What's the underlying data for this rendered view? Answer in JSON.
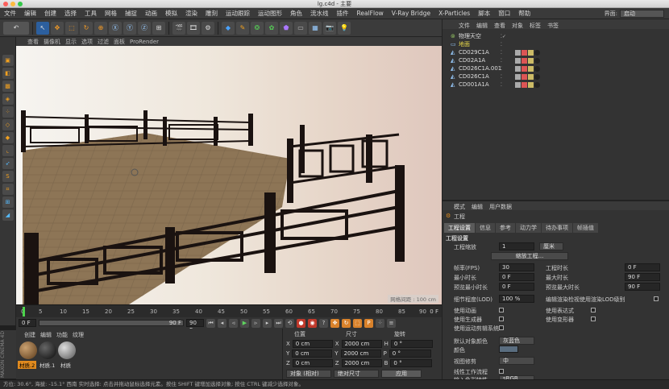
{
  "window": {
    "title": "lg.c4d - 主要"
  },
  "menubar": {
    "items": [
      "文件",
      "编辑",
      "创建",
      "选择",
      "工具",
      "网格",
      "捕捉",
      "动画",
      "模拟",
      "渲染",
      "雕刻",
      "运动跟踪",
      "运动图形",
      "角色",
      "流水线",
      "插件",
      "RealFlow",
      "V-Ray Bridge",
      "X-Particles",
      "脚本",
      "窗口",
      "帮助"
    ],
    "layout_label": "界面:",
    "layout_value": "启动"
  },
  "viewport": {
    "menu": [
      "查看",
      "摄像机",
      "显示",
      "选项",
      "过滤",
      "面板",
      "ProRender"
    ],
    "grid_label": "网格间距 : 100 cm"
  },
  "timeline": {
    "ticks": [
      "0",
      "5",
      "10",
      "15",
      "20",
      "25",
      "30",
      "35",
      "40",
      "45",
      "50",
      "55",
      "60",
      "65",
      "70",
      "75",
      "80",
      "85",
      "90"
    ],
    "frame_label": "0 F",
    "start": "0 F",
    "end_a": "90 F",
    "end_b": "90 F",
    "current_frame": 0
  },
  "material_panel": {
    "menu": [
      "创建",
      "编辑",
      "功能",
      "纹理"
    ],
    "materials": [
      "材质.2",
      "材质.1",
      "材质"
    ]
  },
  "coords": {
    "headers": [
      "位置",
      "尺寸",
      "旋转"
    ],
    "rows": [
      {
        "axis": "X",
        "pos": "0 cm",
        "size": "2000 cm",
        "rot_axis": "H",
        "rot": "0 °"
      },
      {
        "axis": "Y",
        "pos": "0 cm",
        "size": "2000 cm",
        "rot_axis": "P",
        "rot": "0 °"
      },
      {
        "axis": "Z",
        "pos": "0 cm",
        "size": "2000 cm",
        "rot_axis": "B",
        "rot": "0 °"
      }
    ],
    "mode_select": "对象 (相对)",
    "size_select": "绝对尺寸",
    "apply_button": "应用"
  },
  "status_bar": {
    "text": "方位: 30.6°, 海拔: -15.1° 西南   实时选择: 点击并拖动鼠标选择元素。按住 SHIFT 键增加选择对象; 按住 CTRL 键减少选择对象。"
  },
  "maxon_label": "MAXON CINEMA 4D",
  "object_manager": {
    "menu": [
      "文件",
      "编辑",
      "查看",
      "对象",
      "标签",
      "书签"
    ],
    "objects": [
      {
        "name": "物理天空",
        "color": "#9acd32"
      },
      {
        "name": "地面",
        "color": "#e8d94a"
      },
      {
        "name": "CD029C1A",
        "color": "#dddddd"
      },
      {
        "name": "CD02A1A",
        "color": "#dddddd"
      },
      {
        "name": "CD026C1A.001",
        "color": "#dddddd"
      },
      {
        "name": "CD026C1A",
        "color": "#dddddd"
      },
      {
        "name": "CD001A1A",
        "color": "#dddddd"
      }
    ]
  },
  "attribute_manager": {
    "menu": [
      "模式",
      "编辑",
      "用户数据"
    ],
    "title": "工程",
    "tabs": [
      "工程设置",
      "信息",
      "参考",
      "动力学",
      "待办事项",
      "帧插值"
    ],
    "section": "工程设置",
    "scale_label": "工程缩放",
    "scale_value": "1",
    "scale_unit": "厘米",
    "scale_button": "缩放工程...",
    "fields": [
      {
        "label": "帧率(FPS)",
        "value": "30"
      },
      {
        "label": "最小时长",
        "value": "0 F"
      },
      {
        "label": "预览最小时长",
        "value": "0 F"
      }
    ],
    "fields_right": [
      {
        "label": "工程时长",
        "value": "0 F"
      },
      {
        "label": "最大时长",
        "value": "90 F"
      },
      {
        "label": "预览最大时长",
        "value": "90 F"
      }
    ],
    "lod_label": "细节程度(LOD)",
    "lod_value": "100 %",
    "lod_check": "编辑渲染检视使用渲染LOD级别",
    "checks_left": [
      "使用动画",
      "使用生成器",
      "使用运动剪辑系统"
    ],
    "checks_right": [
      "使用表达式",
      "使用变形器"
    ],
    "default_color_label": "默认对象颜色",
    "default_color_value": "灰蓝色",
    "color_label": "颜色",
    "view_clip_label": "视图修剪",
    "view_clip_value": "中",
    "linear_label": "线性工作流程",
    "input_color_label": "输入色彩特性",
    "input_color_value": "sRGB"
  }
}
